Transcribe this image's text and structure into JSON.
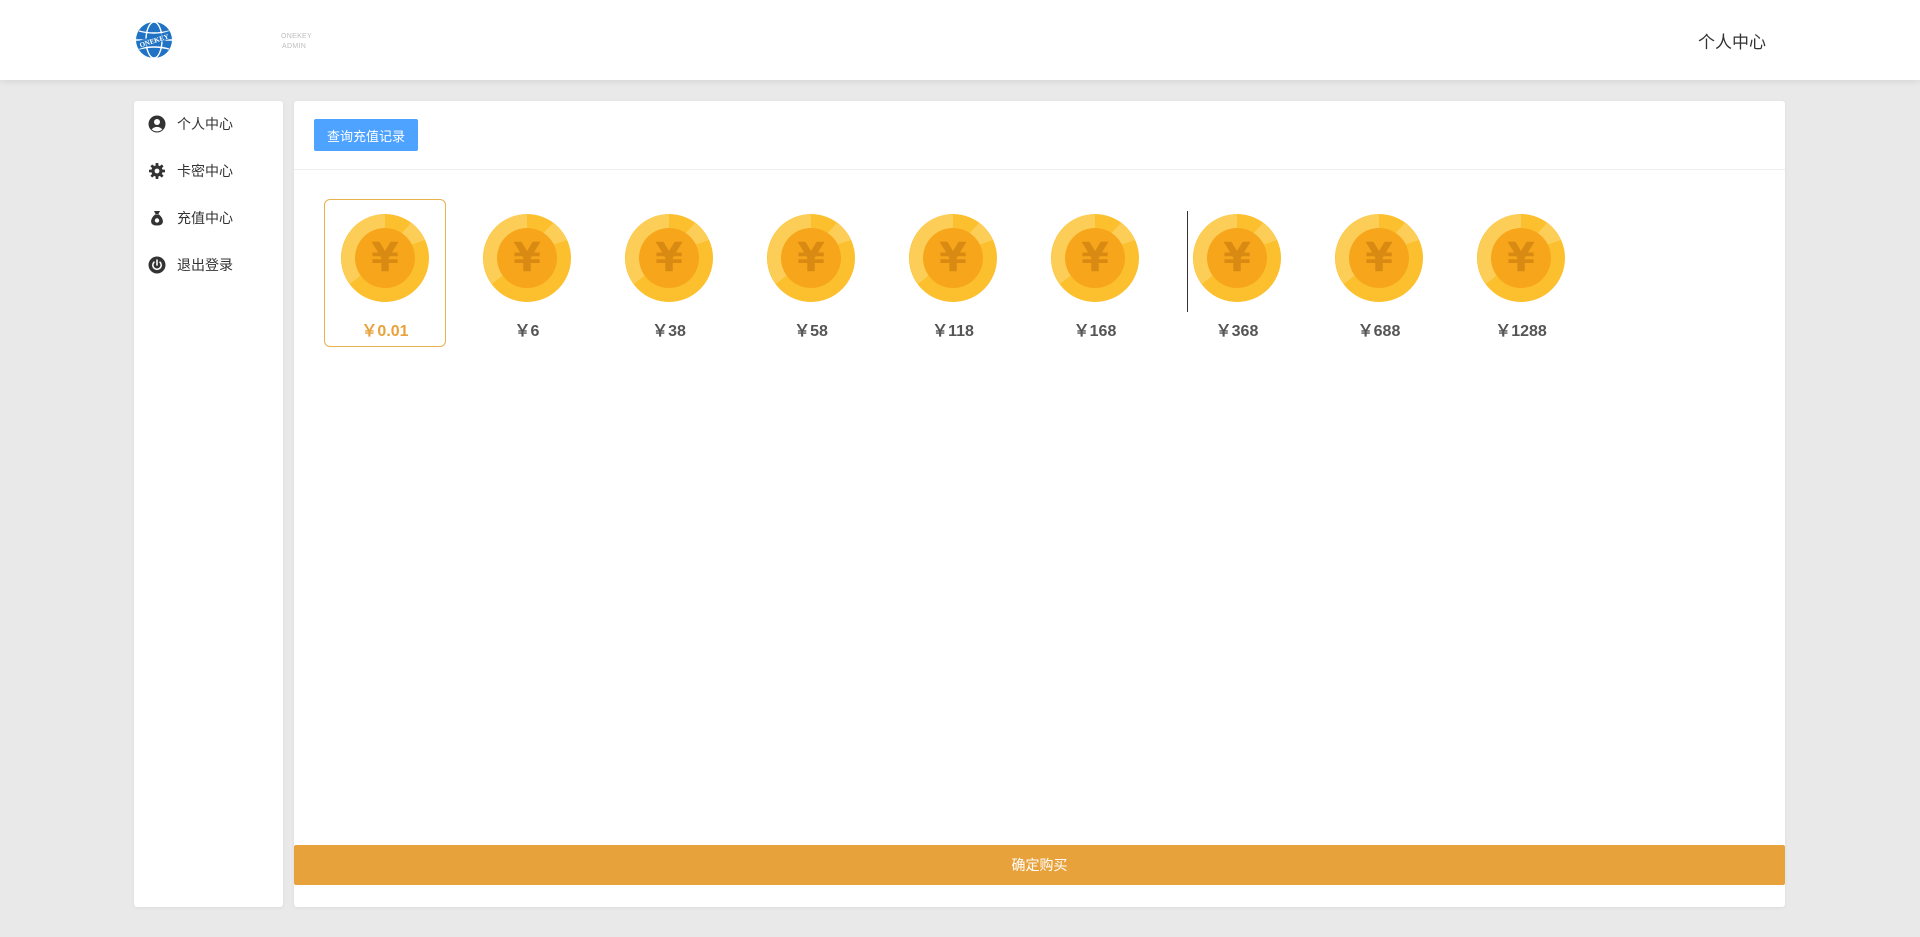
{
  "header": {
    "brand_line1": "ONEKEY",
    "brand_line2": "ADMIN",
    "right_link": "个人中心"
  },
  "sidebar": {
    "items": [
      {
        "label": "个人中心",
        "icon": "user-circle-icon"
      },
      {
        "label": "卡密中心",
        "icon": "gear-icon"
      },
      {
        "label": "充值中心",
        "icon": "money-bag-icon"
      },
      {
        "label": "退出登录",
        "icon": "power-icon"
      }
    ]
  },
  "toolbar": {
    "query_label": "查询充值记录"
  },
  "amounts": [
    {
      "label": "￥0.01",
      "selected": true
    },
    {
      "label": "￥6",
      "selected": false
    },
    {
      "label": "￥38",
      "selected": false
    },
    {
      "label": "￥58",
      "selected": false
    },
    {
      "label": "￥118",
      "selected": false
    },
    {
      "label": "￥168",
      "selected": false
    },
    {
      "label": "￥368",
      "selected": false
    },
    {
      "label": "￥688",
      "selected": false
    },
    {
      "label": "￥1288",
      "selected": false
    }
  ],
  "coin_symbol": "¥",
  "buy_label": "确定购买",
  "colors": {
    "accent_blue": "#4da3ff",
    "accent_orange": "#e8a23c",
    "coin_outer": "#fcc02e",
    "coin_inner": "#f7a51b"
  }
}
